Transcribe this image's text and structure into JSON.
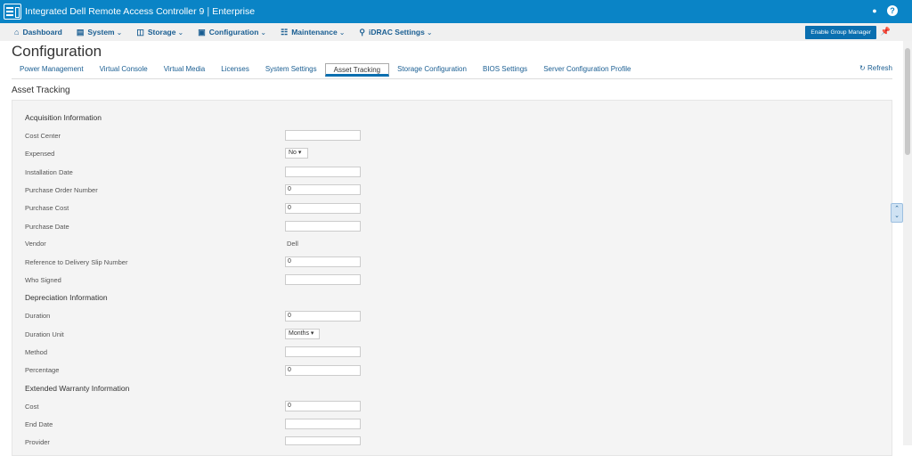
{
  "header": {
    "title": "Integrated Dell Remote Access Controller 9",
    "separator": "|",
    "edition": "Enterprise",
    "user_icon": "user-icon",
    "help_icon": "help-icon"
  },
  "nav": {
    "items": [
      {
        "label": "Dashboard",
        "icon": "home-icon"
      },
      {
        "label": "System",
        "icon": "server-icon"
      },
      {
        "label": "Storage",
        "icon": "storage-icon"
      },
      {
        "label": "Configuration",
        "icon": "configuration-icon"
      },
      {
        "label": "Maintenance",
        "icon": "maintenance-icon"
      },
      {
        "label": "iDRAC Settings",
        "icon": "idrac-settings-icon"
      }
    ],
    "group_manager_button": "Enable Group Manager",
    "pin_icon": "pin-icon"
  },
  "page": {
    "title": "Configuration",
    "tabs": [
      "Power Management",
      "Virtual Console",
      "Virtual Media",
      "Licenses",
      "System Settings",
      "Asset Tracking",
      "Storage Configuration",
      "BIOS Settings",
      "Server Configuration Profile"
    ],
    "active_tab": "Asset Tracking",
    "refresh_label": "Refresh",
    "section_title": "Asset Tracking"
  },
  "acquisition": {
    "title": "Acquisition Information",
    "cost_center_label": "Cost Center",
    "cost_center_value": "",
    "expensed_label": "Expensed",
    "expensed_value": "No",
    "installation_date_label": "Installation Date",
    "installation_date_value": "",
    "purchase_order_label": "Purchase Order Number",
    "purchase_order_value": "0",
    "purchase_cost_label": "Purchase Cost",
    "purchase_cost_value": "0",
    "purchase_date_label": "Purchase Date",
    "purchase_date_value": "",
    "vendor_label": "Vendor",
    "vendor_value": "Dell",
    "delivery_slip_label": "Reference to Delivery Slip Number",
    "delivery_slip_value": "0",
    "who_signed_label": "Who Signed",
    "who_signed_value": ""
  },
  "depreciation": {
    "title": "Depreciation Information",
    "duration_label": "Duration",
    "duration_value": "0",
    "duration_unit_label": "Duration Unit",
    "duration_unit_value": "Months",
    "method_label": "Method",
    "method_value": "",
    "percentage_label": "Percentage",
    "percentage_value": "0"
  },
  "warranty": {
    "title": "Extended Warranty Information",
    "cost_label": "Cost",
    "cost_value": "0",
    "end_date_label": "End Date",
    "end_date_value": "",
    "provider_label": "Provider",
    "provider_value": ""
  }
}
